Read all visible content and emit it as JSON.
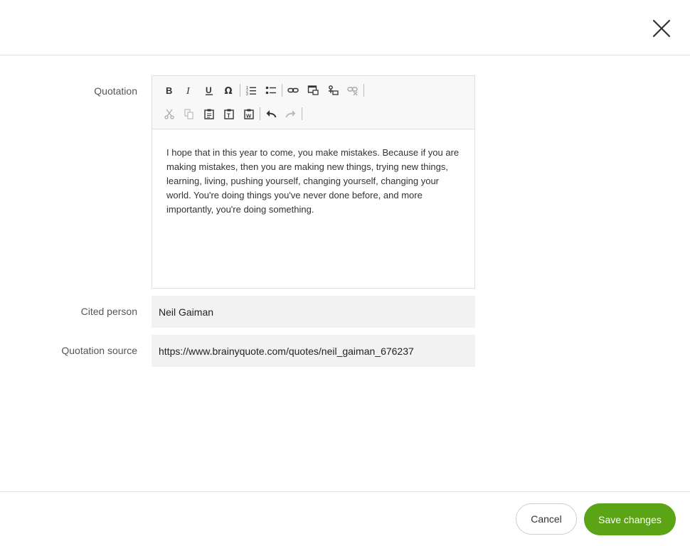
{
  "header": {
    "close_icon": "close-icon"
  },
  "form": {
    "quotation_label": "Quotation",
    "cited_person_label": "Cited person",
    "source_label": "Quotation source",
    "quotation_text": "I hope that in this year to come, you make mistakes. Because if you are making mistakes, then you are making new things, trying new things, learning, living, pushing yourself, changing yourself, changing your world. You're doing things you've never done before, and more importantly, you're doing something.",
    "cited_person_value": "Neil Gaiman",
    "source_value": "https://www.brainyquote.com/quotes/neil_gaiman_676237"
  },
  "toolbar": {
    "row1": [
      "bold-icon",
      "italic-icon",
      "underline-icon",
      "omega-icon",
      "numbered-list-icon",
      "bulleted-list-icon",
      "link-icon",
      "image-icon",
      "anchor-icon",
      "unlink-icon"
    ],
    "row2": [
      "cut-icon",
      "copy-icon",
      "paste-icon",
      "paste-text-icon",
      "paste-word-icon",
      "undo-icon",
      "redo-icon"
    ]
  },
  "footer": {
    "cancel_label": "Cancel",
    "save_label": "Save changes"
  },
  "colors": {
    "accent": "#5ba415",
    "field_bg": "#f2f2f2",
    "toolbar_bg": "#f8f8f8"
  }
}
